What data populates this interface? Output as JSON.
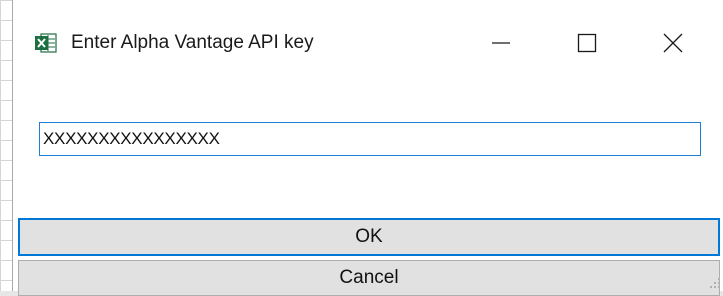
{
  "window": {
    "title": "Enter Alpha Vantage API key",
    "app_icon": "excel-icon",
    "controls": [
      "minimize-icon",
      "maximize-icon",
      "close-icon"
    ]
  },
  "form": {
    "api_key_value": "XXXXXXXXXXXXXXXX"
  },
  "buttons": {
    "ok_label": "OK",
    "cancel_label": "Cancel"
  },
  "colors": {
    "focus_blue": "#0078d7",
    "excel_green": "#1d6f42",
    "button_face": "#e1e1e1"
  }
}
